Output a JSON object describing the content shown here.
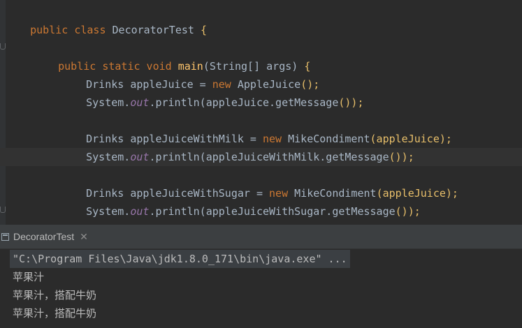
{
  "editor": {
    "lines": {
      "l1": {
        "a": "public class ",
        "b": "DecoratorTest ",
        "c": "{"
      },
      "l3": {
        "a": "public static void ",
        "b": "main",
        "c": "(String[] args) ",
        "d": "{"
      },
      "l4": {
        "a": "Drinks appleJuice = ",
        "b": "new ",
        "c": "AppleJuice",
        "d": "();"
      },
      "l5": {
        "a": "System.",
        "b": "out",
        "c": ".println(appleJuice.getMessage",
        "d": "());"
      },
      "l7": {
        "a": "Drinks appleJuiceWithMilk = ",
        "b": "new ",
        "c": "MikeCondiment",
        "d": "(appleJuice);"
      },
      "l8": {
        "a": "System.",
        "b": "out",
        "c": ".println(appleJuiceWithMilk.getMessage",
        "d": "());"
      },
      "l10": {
        "a": "Drinks appleJuiceWithSugar = ",
        "b": "new ",
        "c": "MikeCondiment",
        "d": "(appleJuice);"
      },
      "l11": {
        "a": "System.",
        "b": "out",
        "c": ".println(appleJuiceWithSugar.getMessage",
        "d": "());"
      },
      "l12": {
        "a": "}"
      }
    }
  },
  "run": {
    "tab_label": "DecoratorTest",
    "close_glyph": "✕",
    "console": {
      "command": "\"C:\\Program Files\\Java\\jdk1.8.0_171\\bin\\java.exe\" ...",
      "out1": "苹果汁",
      "out2": "苹果汁，搭配牛奶",
      "out3": "苹果汁，搭配牛奶"
    }
  },
  "icons": [
    "fold-icon",
    "run-tab-icon",
    "close-icon"
  ]
}
